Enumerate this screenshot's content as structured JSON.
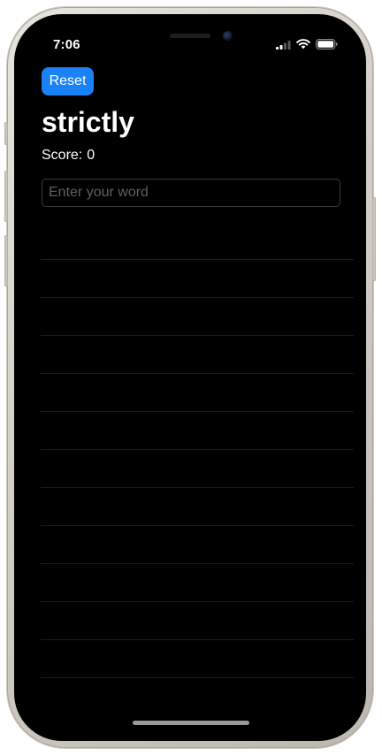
{
  "status_bar": {
    "time": "7:06",
    "icons": [
      "signal-icon",
      "wifi-icon",
      "battery-icon"
    ]
  },
  "toolbar": {
    "reset_label": "Reset"
  },
  "game": {
    "root_word": "strictly",
    "score_label": "Score:",
    "score_value": "0"
  },
  "word_input": {
    "placeholder": "Enter your word",
    "value": ""
  },
  "used_words": [
    "",
    "",
    "",
    "",
    "",
    "",
    "",
    "",
    "",
    "",
    "",
    ""
  ],
  "colors": {
    "accent": "#1a82f7",
    "background": "#000000",
    "text": "#ffffff"
  }
}
